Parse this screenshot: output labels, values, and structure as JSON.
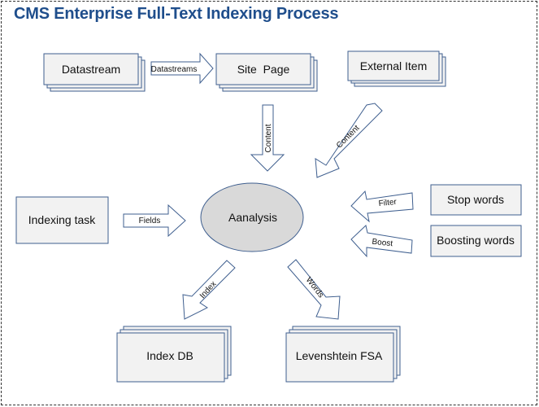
{
  "title": "CMS Enterprise Full-Text Indexing Process",
  "nodes": {
    "datastream": "Datastream",
    "site_page": "Site  Page",
    "external_item": "External Item",
    "indexing_task": "Indexing task",
    "analysis": "Aanalysis",
    "stop_words": "Stop words",
    "boosting_words": "Boosting words",
    "index_db": "Index DB",
    "levenshtein_fsa": "Levenshtein FSA"
  },
  "arrows": {
    "datastreams": "Datastreams",
    "content_vertical": "Content",
    "content_diagonal": "Content",
    "fields": "Fields",
    "filter": "Filter",
    "boost": "Boost",
    "index": "Index",
    "words": "Words"
  }
}
